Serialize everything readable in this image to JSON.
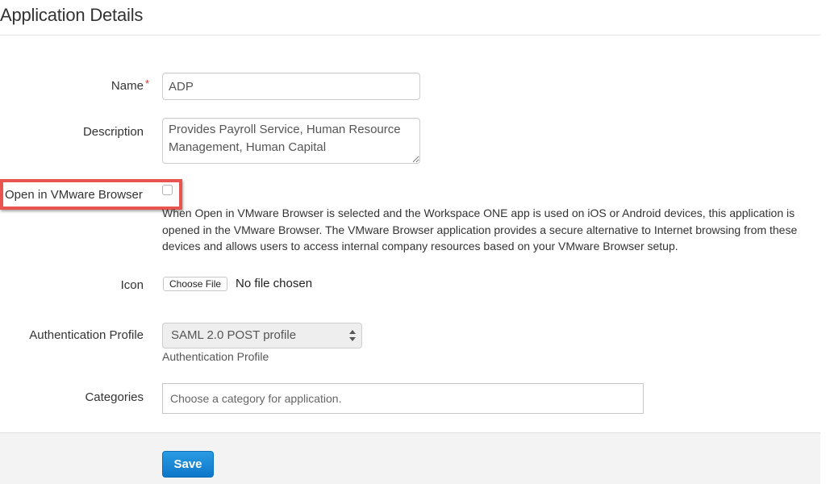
{
  "header": {
    "title": "Application Details"
  },
  "form": {
    "name": {
      "label": "Name",
      "required_marker": "*",
      "value": "ADP"
    },
    "description": {
      "label": "Description",
      "value": "Provides Payroll Service, Human Resource Management, Human Capital"
    },
    "open_in_browser": {
      "label": "Open in VMware Browser",
      "checked": false,
      "help_text": "When Open in VMware Browser is selected and the Workspace ONE app is used on iOS or Android devices, this application is opened in the VMware Browser. The VMware Browser application provides a secure alternative to Internet browsing from these devices and allows users to access internal company resources based on your VMware Browser setup."
    },
    "icon": {
      "label": "Icon",
      "button_label": "Choose File",
      "status": "No file chosen"
    },
    "auth_profile": {
      "label": "Authentication Profile",
      "selected": "SAML 2.0 POST profile",
      "help_text": "Authentication Profile"
    },
    "categories": {
      "label": "Categories",
      "placeholder": "Choose a category for application.",
      "value": ""
    }
  },
  "footer": {
    "save_label": "Save"
  },
  "colors": {
    "highlight": "#e8554e",
    "primary_button": "#1a8ad8",
    "required": "#c9302c"
  }
}
